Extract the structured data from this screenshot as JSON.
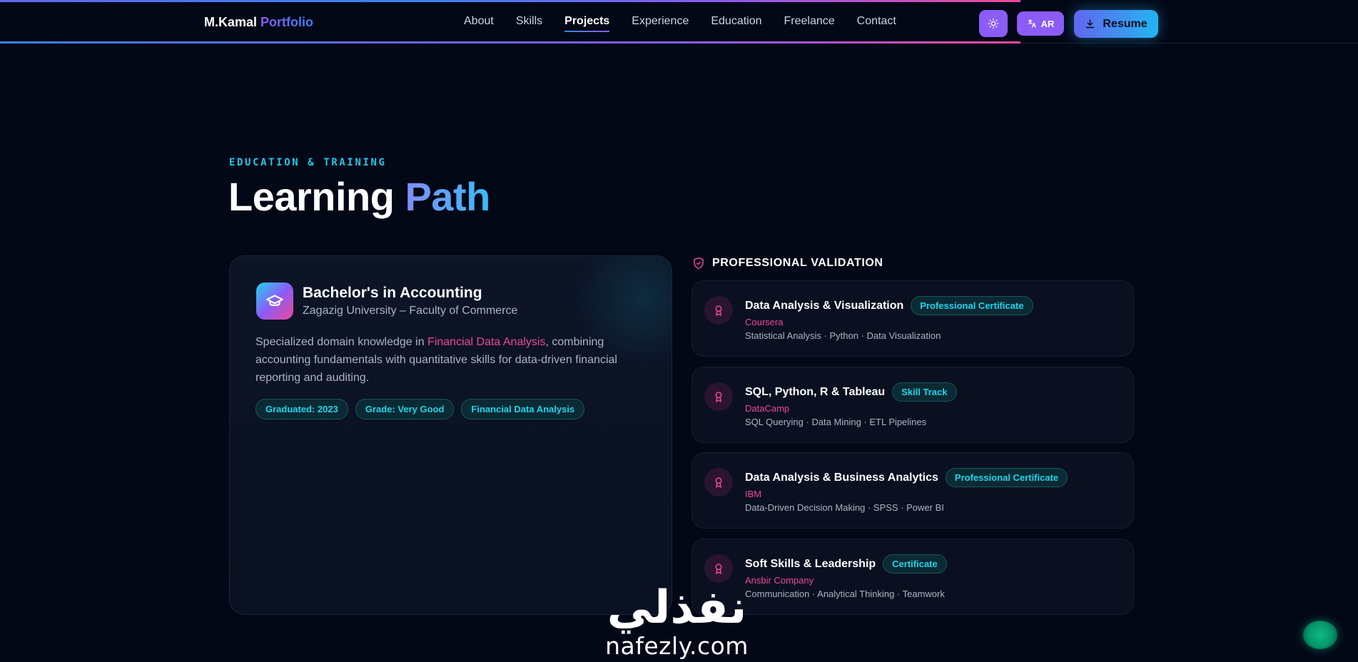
{
  "brand": {
    "name": "M.Kamal",
    "accent": "Portfolio"
  },
  "nav": {
    "items": [
      "About",
      "Skills",
      "Projects",
      "Experience",
      "Education",
      "Freelance",
      "Contact"
    ],
    "active": "Projects"
  },
  "actions": {
    "lang_label": "AR",
    "resume_label": "Resume"
  },
  "section": {
    "eyebrow": "EDUCATION & TRAINING",
    "title_plain": "Learning",
    "title_accent": "Path"
  },
  "education": {
    "title": "Bachelor's in Accounting",
    "institution": "Zagazig University – Faculty of Commerce",
    "desc_before": "Specialized domain knowledge in ",
    "desc_highlight": "Financial Data Analysis",
    "desc_after": ", combining accounting fundamentals with quantitative skills for data-driven financial reporting and auditing.",
    "tags": [
      "Graduated: 2023",
      "Grade: Very Good",
      "Financial Data Analysis"
    ]
  },
  "validation": {
    "heading": "PROFESSIONAL VALIDATION",
    "certs": [
      {
        "name": "Data Analysis & Visualization",
        "badge": "Professional Certificate",
        "issuer": "Coursera",
        "skills": "Statistical Analysis · Python · Data Visualization"
      },
      {
        "name": "SQL, Python, R & Tableau",
        "badge": "Skill Track",
        "issuer": "DataCamp",
        "skills": "SQL Querying · Data Mining · ETL Pipelines"
      },
      {
        "name": "Data Analysis & Business Analytics",
        "badge": "Professional Certificate",
        "issuer": "IBM",
        "skills": "Data-Driven Decision Making · SPSS · Power BI"
      },
      {
        "name": "Soft Skills & Leadership",
        "badge": "Certificate",
        "issuer": "Ansbir Company",
        "skills": "Communication · Analytical Thinking · Teamwork"
      }
    ]
  },
  "watermark": {
    "arabic": "نفذلي",
    "latin": "nafezly.com"
  },
  "colors": {
    "accent_cyan": "#22d3ee",
    "accent_pink": "#ec4899",
    "accent_violet": "#8b5cf6",
    "background": "#030817"
  }
}
